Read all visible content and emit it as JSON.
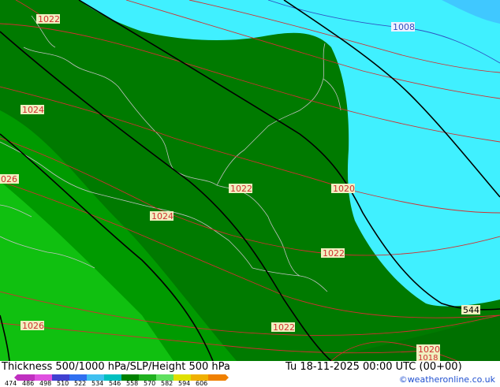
{
  "map": {
    "isobar_labels": [
      {
        "text": "1022",
        "color": "#d03030"
      },
      {
        "text": "1008",
        "color": "#3050c0"
      },
      {
        "text": "1024",
        "color": "#d03030"
      },
      {
        "text": "1022",
        "color": "#d03030"
      },
      {
        "text": "1020",
        "color": "#d03030"
      },
      {
        "text": "026",
        "color": "#d03030"
      },
      {
        "text": "1024",
        "color": "#d03030"
      },
      {
        "text": "1022",
        "color": "#d03030"
      },
      {
        "text": "1026",
        "color": "#d03030"
      },
      {
        "text": "1022",
        "color": "#d03030"
      },
      {
        "text": "1020",
        "color": "#d03030"
      },
      {
        "text": "1018",
        "color": "#d03030"
      }
    ],
    "height_label": "544"
  },
  "footer": {
    "title": "Thickness 500/1000 hPa/SLP/Height 500 hPa",
    "time": "Tu 18-11-2025 00:00 UTC (00+00)",
    "credit": "©weatheronline.co.uk",
    "scale_ticks": [
      "474",
      "486",
      "498",
      "510",
      "522",
      "534",
      "546",
      "558",
      "570",
      "582",
      "594",
      "606"
    ],
    "scale_colors": [
      "#c030c0",
      "#e050e0",
      "#4040d0",
      "#3070f0",
      "#40c0f0",
      "#00c0c0",
      "#008000",
      "#20b020",
      "#60e060",
      "#e0e000",
      "#f0b000",
      "#f08000"
    ]
  },
  "colors": {
    "sea_cyan": "#40f0ff",
    "dark_green": "#007a00",
    "mid_green": "#009a00",
    "light_green": "#10c010",
    "isobar": "#d03030",
    "border": "#c0c0c0"
  }
}
